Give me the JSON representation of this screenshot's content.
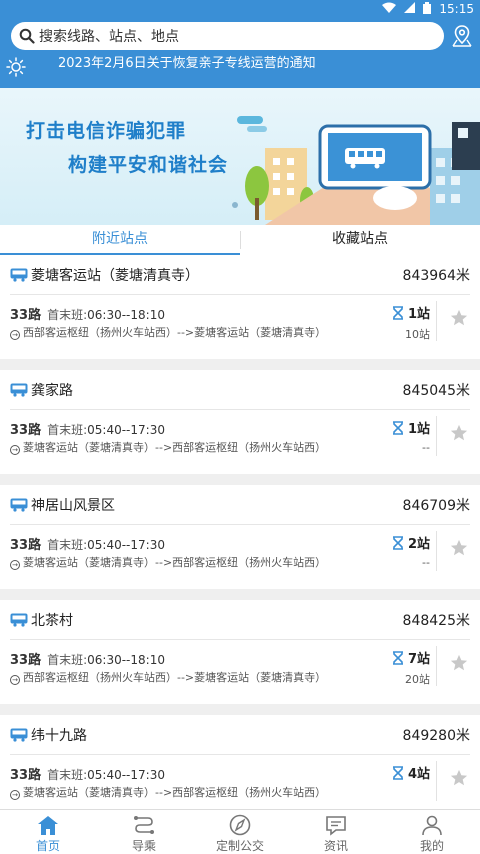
{
  "status_bar": {
    "time": "15:15"
  },
  "search": {
    "placeholder": "搜索线路、站点、地点"
  },
  "notice": {
    "text": "2023年2月6日关于恢复亲子专线运营的通知"
  },
  "banner": {
    "line1": "打击电信诈骗犯罪",
    "line2": "构建平安和谐社会"
  },
  "tabs": [
    {
      "label": "附近站点",
      "active": true
    },
    {
      "label": "收藏站点",
      "active": false
    }
  ],
  "stops": [
    {
      "name": "菱塘客运站（菱塘清真寺）",
      "distance": "843964米",
      "route": {
        "line": "33路",
        "schedule_label": "首末班:",
        "schedule": "06:30--18:10",
        "direction": "西部客运枢纽（扬州火车站西）-->菱塘客运站（菱塘清真寺）",
        "eta": "1站",
        "eta_sub": "10站"
      }
    },
    {
      "name": "龚家路",
      "distance": "845045米",
      "route": {
        "line": "33路",
        "schedule_label": "首末班:",
        "schedule": "05:40--17:30",
        "direction": "菱塘客运站（菱塘清真寺）-->西部客运枢纽（扬州火车站西）",
        "eta": "1站",
        "eta_sub": "--"
      }
    },
    {
      "name": "神居山风景区",
      "distance": "846709米",
      "route": {
        "line": "33路",
        "schedule_label": "首末班:",
        "schedule": "05:40--17:30",
        "direction": "菱塘客运站（菱塘清真寺）-->西部客运枢纽（扬州火车站西）",
        "eta": "2站",
        "eta_sub": "--"
      }
    },
    {
      "name": "北茶村",
      "distance": "848425米",
      "route": {
        "line": "33路",
        "schedule_label": "首末班:",
        "schedule": "06:30--18:10",
        "direction": "西部客运枢纽（扬州火车站西）-->菱塘客运站（菱塘清真寺）",
        "eta": "7站",
        "eta_sub": "20站"
      }
    },
    {
      "name": "纬十九路",
      "distance": "849280米",
      "route": {
        "line": "33路",
        "schedule_label": "首末班:",
        "schedule": "05:40--17:30",
        "direction": "菱塘客运站（菱塘清真寺）-->西部客运枢纽（扬州火车站西）",
        "eta": "4站",
        "eta_sub": ""
      }
    }
  ],
  "nav": [
    {
      "label": "首页",
      "icon": "home-icon",
      "active": true
    },
    {
      "label": "导乘",
      "icon": "route-guide-icon",
      "active": false
    },
    {
      "label": "定制公交",
      "icon": "compass-icon",
      "active": false
    },
    {
      "label": "资讯",
      "icon": "message-icon",
      "active": false
    },
    {
      "label": "我的",
      "icon": "user-icon",
      "active": false
    }
  ],
  "colors": {
    "primary": "#3a8fd6",
    "banner_text": "#1f7fc9"
  }
}
